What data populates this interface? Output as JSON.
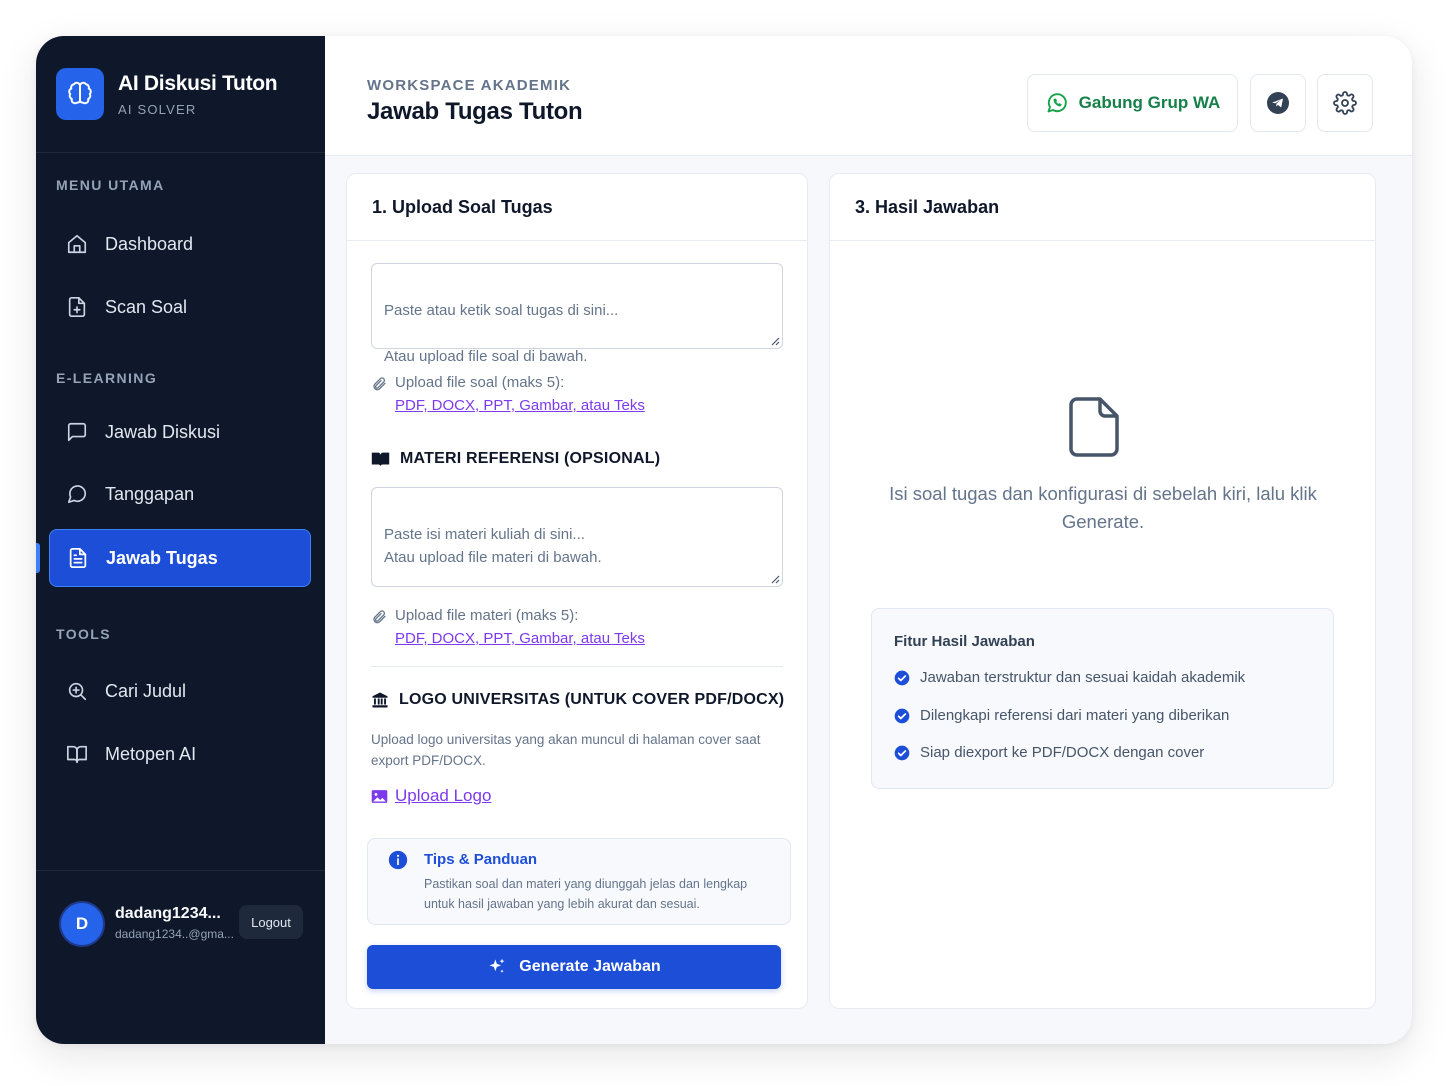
{
  "brand": {
    "title": "AI Diskusi Tuton",
    "subtitle": "AI SOLVER",
    "logo_icon": "brain-icon"
  },
  "sidebar": {
    "sections": [
      {
        "label": "MENU UTAMA",
        "items": [
          {
            "label": "Dashboard",
            "icon": "home-icon"
          },
          {
            "label": "Scan Soal",
            "icon": "file-plus-icon"
          }
        ]
      },
      {
        "label": "E-LEARNING",
        "items": [
          {
            "label": "Jawab Diskusi",
            "icon": "message-square-icon"
          },
          {
            "label": "Tanggapan",
            "icon": "message-circle-icon"
          },
          {
            "label": "Jawab Tugas",
            "icon": "file-text-icon",
            "active": true
          }
        ]
      },
      {
        "label": "TOOLS",
        "items": [
          {
            "label": "Cari Judul",
            "icon": "search-plus-icon"
          },
          {
            "label": "Metopen AI",
            "icon": "book-open-icon"
          }
        ]
      }
    ]
  },
  "user": {
    "initial": "D",
    "name": "dadang1234...",
    "email": "dadang1234..@gma...",
    "logout_label": "Logout"
  },
  "header": {
    "eyebrow": "WORKSPACE AKADEMIK",
    "title": "Jawab Tugas Tuton",
    "wa_label": "Gabung Grup WA",
    "telegram_icon": "telegram-icon",
    "settings_icon": "gear-icon"
  },
  "upload_card": {
    "title": "1. Upload Soal Tugas",
    "question_placeholder": "Paste atau ketik soal tugas di sini...\n\nAtau upload file soal di bawah.",
    "question_upload_label": "Upload file soal (maks 5):",
    "question_upload_link": "PDF, DOCX, PPT, Gambar, atau Teks",
    "reference_heading": "MATERI REFERENSI (OPSIONAL)",
    "reference_placeholder": "Paste isi materi kuliah di sini...\nAtau upload file materi di bawah.",
    "reference_upload_label": "Upload file materi (maks 5):",
    "reference_upload_link": "PDF, DOCX, PPT, Gambar, atau Teks",
    "logo_heading": "LOGO UNIVERSITAS (UNTUK COVER PDF/DOCX)",
    "logo_desc": "Upload logo universitas yang akan muncul di halaman cover saat export PDF/DOCX.",
    "logo_link": "Upload Logo",
    "tips_title": "Tips & Panduan",
    "tips_text": "Pastikan soal dan materi yang diunggah jelas dan lengkap untuk hasil jawaban yang lebih akurat dan sesuai.",
    "generate_label": "Generate Jawaban"
  },
  "result_card": {
    "title": "3. Hasil Jawaban",
    "empty_text": "Isi soal tugas dan konfigurasi di sebelah kiri, lalu klik Generate.",
    "features_title": "Fitur Hasil Jawaban",
    "features": [
      "Jawaban terstruktur dan sesuai kaidah akademik",
      "Dilengkapi referensi dari materi yang diberikan",
      "Siap diexport ke PDF/DOCX dengan cover"
    ]
  },
  "colors": {
    "sidebar_bg": "#0f172a",
    "accent": "#1d4ed8",
    "link": "#7c3aed",
    "whatsapp": "#16804a"
  }
}
